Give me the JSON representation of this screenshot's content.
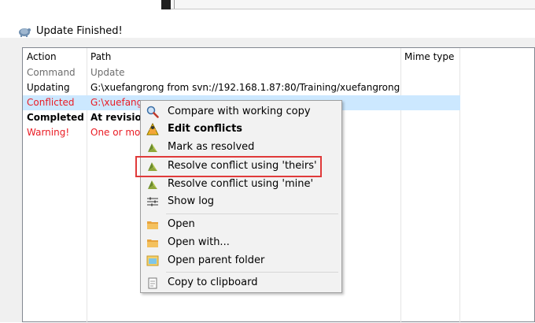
{
  "window": {
    "title": "Update Finished!"
  },
  "table": {
    "columns": [
      "Action",
      "Path",
      "Mime type"
    ],
    "rows": [
      {
        "action": "Command",
        "path": "Update",
        "style": "gray"
      },
      {
        "action": "Updating",
        "path": "G:\\xuefangrong from svn://192.168.1.87:80/Training/xuefangrong",
        "style": "normal"
      },
      {
        "action": "Conflicted",
        "path": "G:\\xuefang...",
        "style": "red"
      },
      {
        "action": "Completed",
        "path": "At revisio...",
        "style": "bold"
      },
      {
        "action": "Warning!",
        "path": "One or mo...",
        "style": "red"
      }
    ]
  },
  "context_menu": {
    "items": [
      {
        "label": "Compare with working copy",
        "icon": "magnifier-icon"
      },
      {
        "label": "Edit conflicts",
        "icon": "edit-conflicts-icon"
      },
      {
        "label": "Mark as resolved",
        "icon": "resolved-icon"
      },
      {
        "label": "Resolve conflict using 'theirs'",
        "icon": "resolve-theirs-icon"
      },
      {
        "label": "Resolve conflict using 'mine'",
        "icon": "resolve-mine-icon"
      },
      {
        "label": "Show log",
        "icon": "log-icon"
      },
      {
        "label": "Open",
        "icon": "open-folder-icon"
      },
      {
        "label": "Open with...",
        "icon": "open-with-icon"
      },
      {
        "label": "Open parent folder",
        "icon": "parent-folder-icon"
      },
      {
        "label": "Copy to clipboard",
        "icon": "clipboard-icon"
      }
    ]
  },
  "colors": {
    "conflict_text": "#ea1c24",
    "selection": "#cce8ff",
    "highlight_box": "#e03a3a"
  }
}
